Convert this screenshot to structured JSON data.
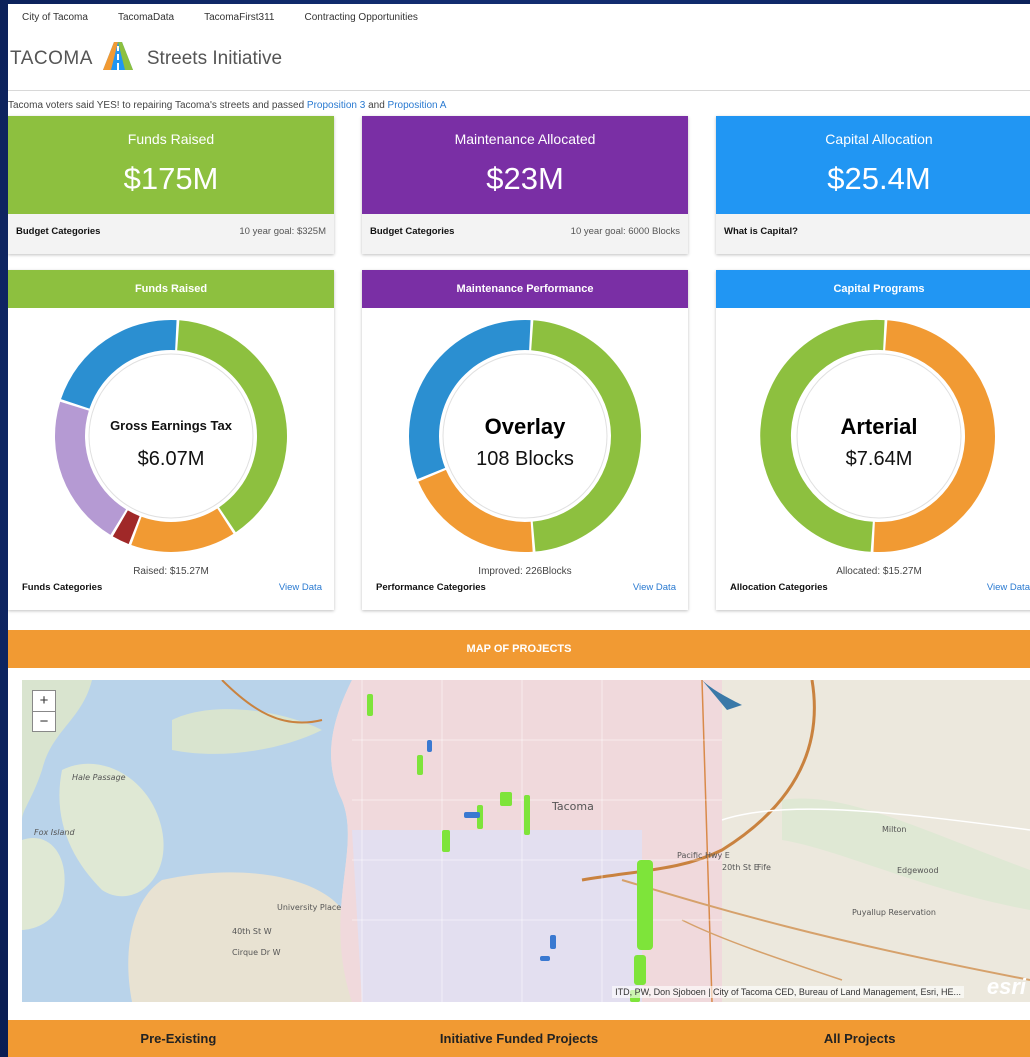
{
  "nav": [
    "City of Tacoma",
    "TacomaData",
    "TacomaFirst311",
    "Contracting Opportunities"
  ],
  "brand": {
    "word": "TACOMA",
    "subtitle": "Streets Initiative"
  },
  "intro": {
    "text": "Tacoma voters said YES! to repairing Tacoma's streets and passed",
    "link1": "Proposition 3",
    "and": "and",
    "link2": "Proposition A"
  },
  "stats": [
    {
      "title": "Funds Raised",
      "value": "$175M",
      "foot_left": "Budget Categories",
      "foot_right": "10 year goal: $325M",
      "color": "#8dc03f"
    },
    {
      "title": "Maintenance Allocated",
      "value": "$23M",
      "foot_left": "Budget Categories",
      "foot_right": "10 year goal: 6000 Blocks",
      "color": "#7a2fa5"
    },
    {
      "title": "Capital Allocation",
      "value": "$25.4M",
      "foot_left": "What is Capital?",
      "foot_right": "",
      "color": "#2196f3"
    }
  ],
  "donuts": [
    {
      "header": "Funds Raised",
      "label": "Gross Earnings Tax",
      "value": "$6.07M",
      "total": "Raised: $15.27M",
      "foot_left": "Funds Categories",
      "view": "View Data",
      "segments": [
        {
          "share": 0.398,
          "color": "#8dc03f"
        },
        {
          "share": 0.15,
          "color": "#f19a33"
        },
        {
          "share": 0.028,
          "color": "#a02828"
        },
        {
          "share": 0.214,
          "color": "#b59ad3"
        },
        {
          "share": 0.21,
          "color": "#2b8fd1"
        }
      ]
    },
    {
      "header": "Maintenance Performance",
      "label": "Overlay",
      "value": "108 Blocks",
      "total": "Improved: 226Blocks",
      "foot_left": "Performance Categories",
      "view": "View Data",
      "segments": [
        {
          "share": 0.478,
          "color": "#8dc03f"
        },
        {
          "share": 0.2,
          "color": "#f19a33"
        },
        {
          "share": 0.322,
          "color": "#2b8fd1"
        }
      ]
    },
    {
      "header": "Capital Programs",
      "label": "Arterial",
      "value": "$7.64M",
      "total": "Allocated: $15.27M",
      "foot_left": "Allocation Categories",
      "view": "View Data",
      "segments": [
        {
          "share": 0.5,
          "color": "#f19a33"
        },
        {
          "share": 0.5,
          "color": "#8dc03f"
        }
      ]
    }
  ],
  "map": {
    "title": "MAP OF PROJECTS",
    "zoom_in": "+",
    "zoom_out": "−",
    "attribution": "ITD, PW, Don Sjoboen | City of Tacoma CED, Bureau of Land Management, Esri, HE...",
    "esri": "esri",
    "labels": [
      "Tacoma",
      "Hale Passage",
      "Fox Island",
      "University Place",
      "Fife",
      "Milton",
      "Edgewood",
      "Puyallup Reservation",
      "Pacific Hwy E",
      "20th St E",
      "40th St W",
      "Cirque Dr W"
    ]
  },
  "tabs": [
    "Pre-Existing",
    "Initiative Funded Projects",
    "All Projects"
  ]
}
